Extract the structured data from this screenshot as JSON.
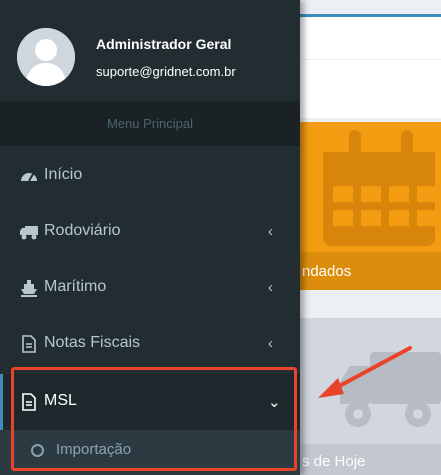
{
  "user": {
    "name": "Administrador Geral",
    "email": "suporte@gridnet.com.br"
  },
  "menu": {
    "header": "Menu Principal",
    "items": [
      {
        "label": "Início",
        "icon": "dashboard-icon",
        "has_children": false
      },
      {
        "label": "Rodoviário",
        "icon": "truck-icon",
        "has_children": true
      },
      {
        "label": "Marítimo",
        "icon": "ship-icon",
        "has_children": true
      },
      {
        "label": "Notas Fiscais",
        "icon": "file-icon",
        "has_children": true
      },
      {
        "label": "MSL",
        "icon": "file-text-icon",
        "has_children": true,
        "expanded": true
      }
    ],
    "submenu": [
      {
        "label": "Importação",
        "icon": "circle-icon"
      }
    ]
  },
  "cards": {
    "orange_footer": "ndados",
    "gray_footer": "s de Hoje"
  },
  "colors": {
    "sidebar": "#222d32",
    "accent": "#3c8dbc",
    "orange": "#f39c12",
    "gray": "#d2d6de",
    "highlight": "#e8442a"
  }
}
